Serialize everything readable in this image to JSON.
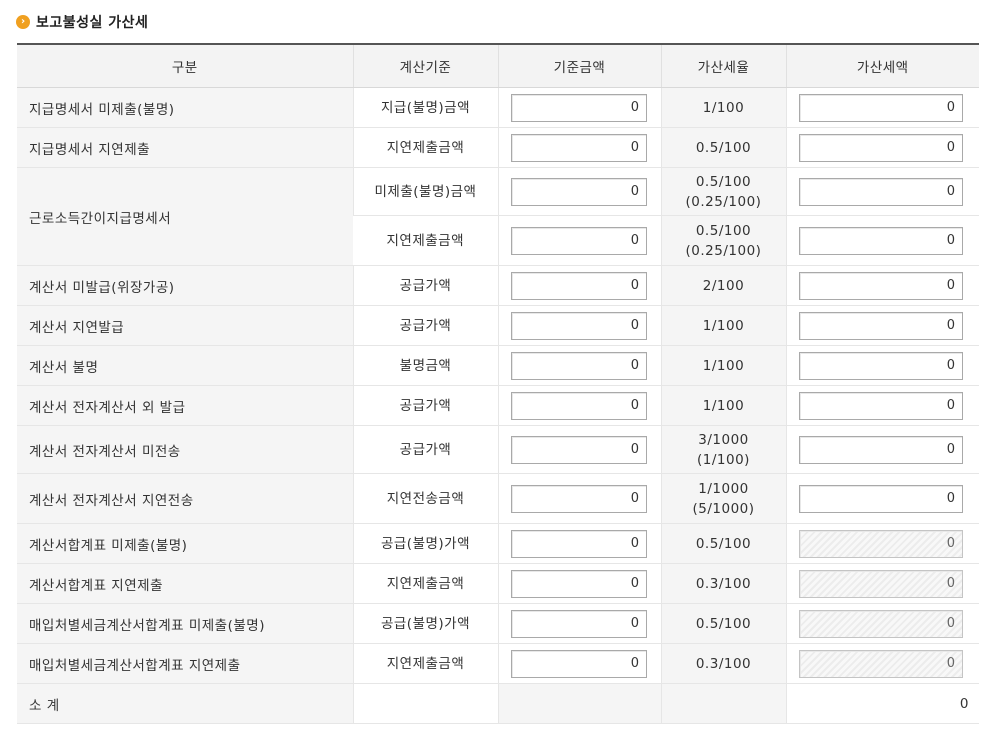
{
  "section_title": "보고불성실 가산세",
  "headers": [
    "구분",
    "계산기준",
    "기준금액",
    "가산세율",
    "가산세액"
  ],
  "rows": [
    {
      "label": "지급명세서 미제출(불명)",
      "basis": "지급(불명)금액",
      "rate": "1/100",
      "amount": "0",
      "tax": "0",
      "tax_disabled": false
    },
    {
      "label": "지급명세서 지연제출",
      "basis": "지연제출금액",
      "rate": "0.5/100",
      "amount": "0",
      "tax": "0",
      "tax_disabled": false
    },
    {
      "label": "근로소득간이지급명세서",
      "basis": "미제출(불명)금액",
      "rate": "0.5/100\n(0.25/100)",
      "amount": "0",
      "tax": "0",
      "tax_disabled": false
    },
    {
      "label": "",
      "basis": "지연제출금액",
      "rate": "0.5/100\n(0.25/100)",
      "amount": "0",
      "tax": "0",
      "tax_disabled": false
    },
    {
      "label": "계산서 미발급(위장가공)",
      "basis": "공급가액",
      "rate": "2/100",
      "amount": "0",
      "tax": "0",
      "tax_disabled": false
    },
    {
      "label": "계산서 지연발급",
      "basis": "공급가액",
      "rate": "1/100",
      "amount": "0",
      "tax": "0",
      "tax_disabled": false
    },
    {
      "label": "계산서 불명",
      "basis": "불명금액",
      "rate": "1/100",
      "amount": "0",
      "tax": "0",
      "tax_disabled": false
    },
    {
      "label": "계산서 전자계산서 외 발급",
      "basis": "공급가액",
      "rate": "1/100",
      "amount": "0",
      "tax": "0",
      "tax_disabled": false
    },
    {
      "label": "계산서 전자계산서 미전송",
      "basis": "공급가액",
      "rate": "3/1000\n(1/100)",
      "amount": "0",
      "tax": "0",
      "tax_disabled": false
    },
    {
      "label": "계산서 전자계산서 지연전송",
      "basis": "지연전송금액",
      "rate": "1/1000\n(5/1000)",
      "amount": "0",
      "tax": "0",
      "tax_disabled": false
    },
    {
      "label": "계산서합계표 미제출(불명)",
      "basis": "공급(불명)가액",
      "rate": "0.5/100",
      "amount": "0",
      "tax": "0",
      "tax_disabled": true
    },
    {
      "label": "계산서합계표 지연제출",
      "basis": "지연제출금액",
      "rate": "0.3/100",
      "amount": "0",
      "tax": "0",
      "tax_disabled": true
    },
    {
      "label": "매입처별세금계산서합계표 미제출(불명)",
      "basis": "공급(불명)가액",
      "rate": "0.5/100",
      "amount": "0",
      "tax": "0",
      "tax_disabled": true
    },
    {
      "label": "매입처별세금계산서합계표 지연제출",
      "basis": "지연제출금액",
      "rate": "0.3/100",
      "amount": "0",
      "tax": "0",
      "tax_disabled": true
    }
  ],
  "subtotal": {
    "label": "소 계",
    "value": "0"
  },
  "colors": {
    "accent": "#f0a020",
    "header_bg": "#f3f3f3",
    "label_bg": "#f5f5f5"
  }
}
